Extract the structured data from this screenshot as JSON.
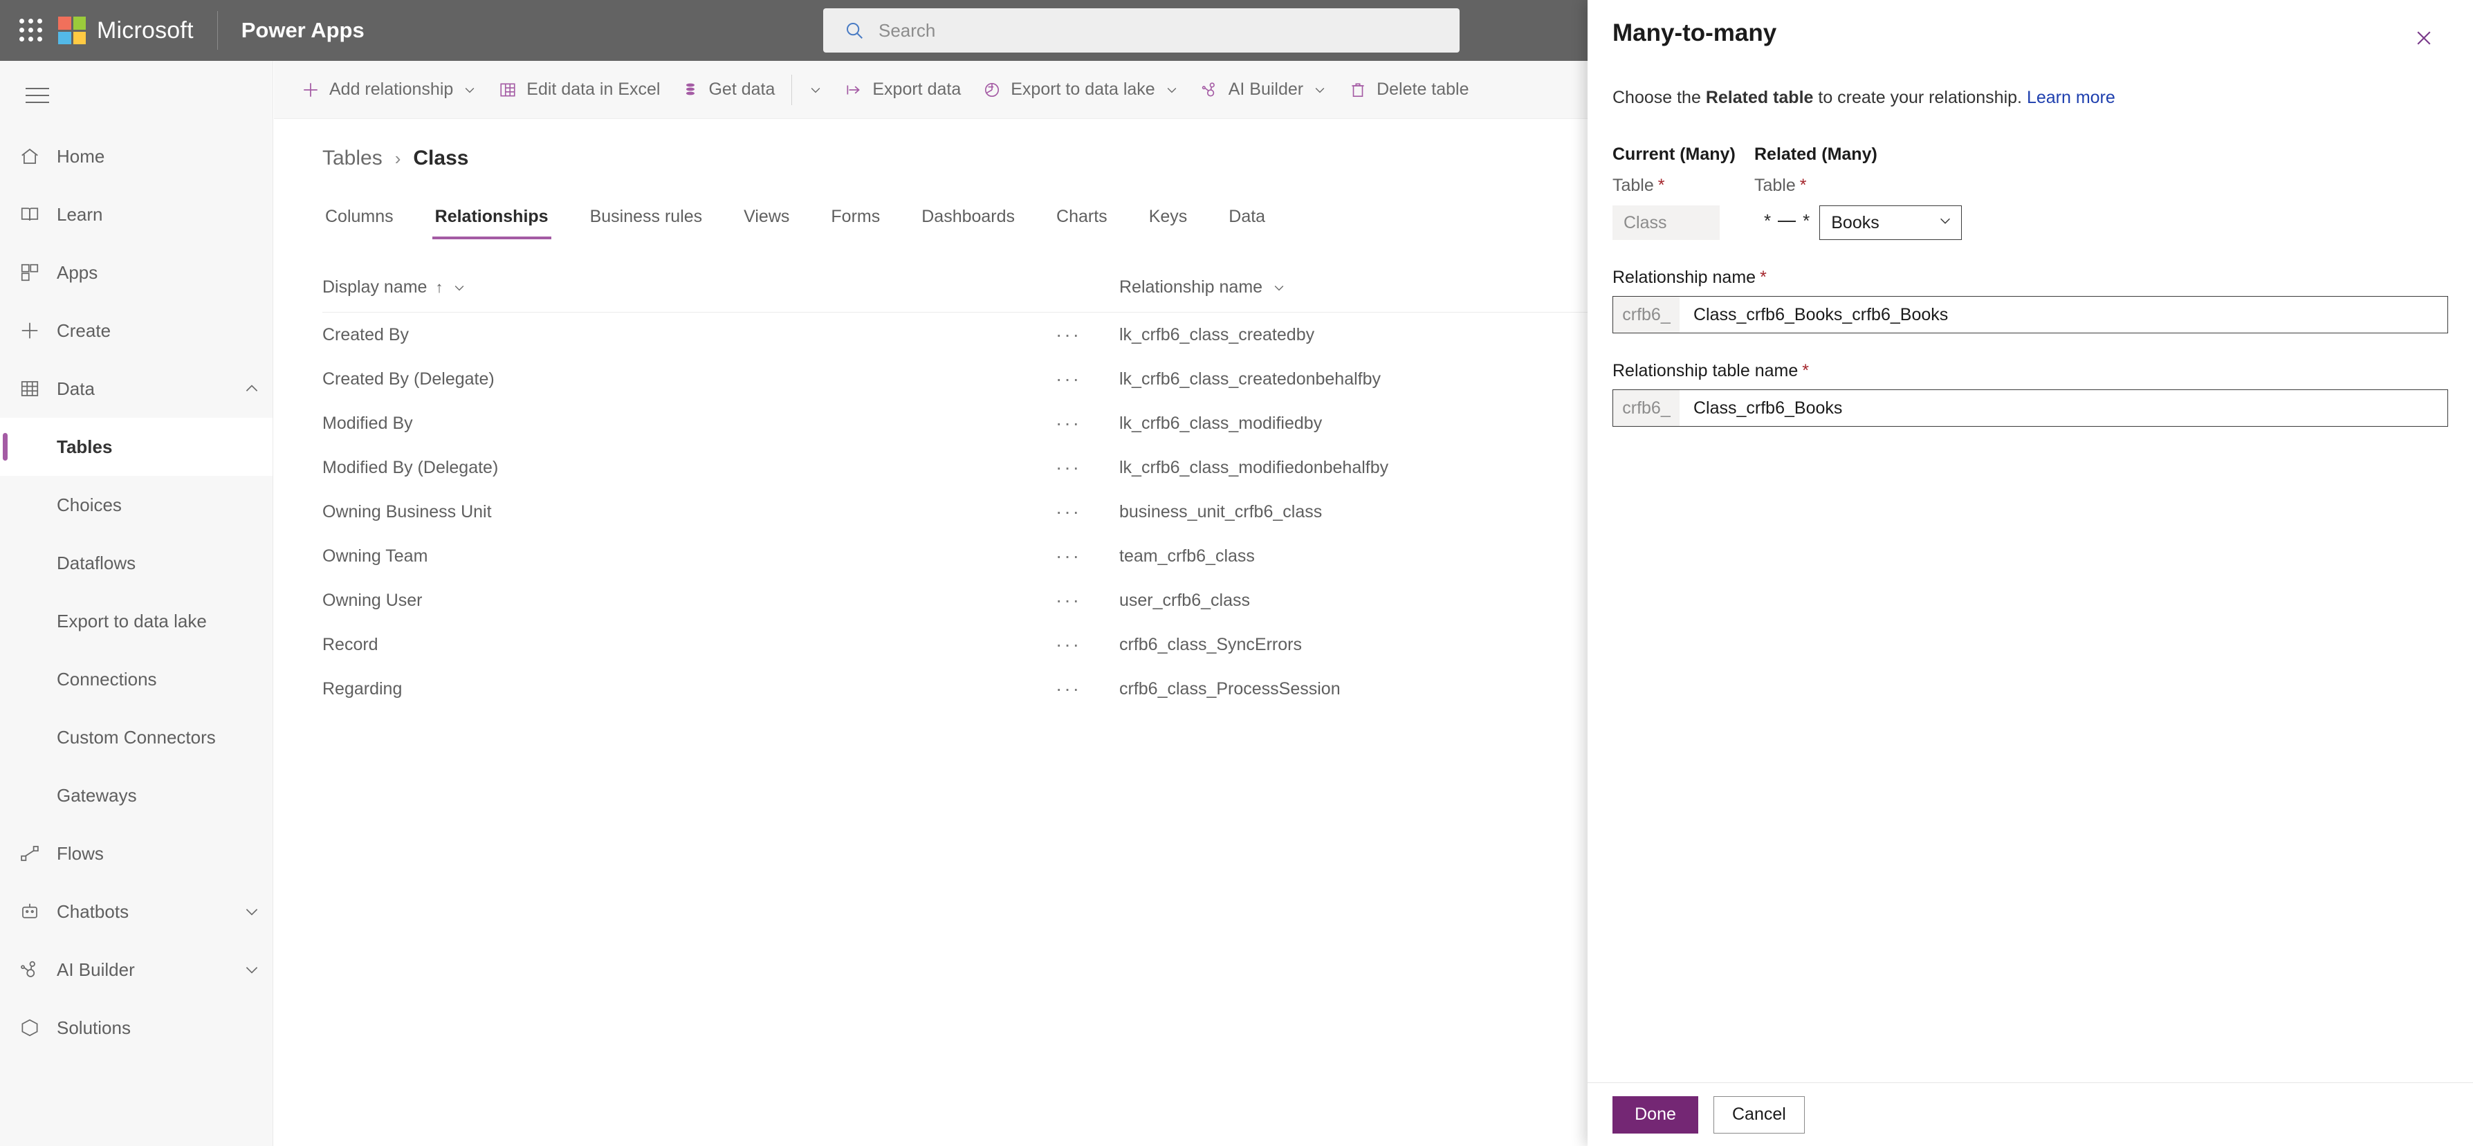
{
  "topbar": {
    "waffle_icon": "app-launcher-icon",
    "brand": "Microsoft",
    "app_name": "Power Apps",
    "search": {
      "placeholder": "Search",
      "value": "",
      "icon": "search-icon"
    }
  },
  "sidebar": {
    "menu_icon": "hamburger-icon",
    "items": [
      {
        "label": "Home",
        "icon": "home-icon",
        "type": "item",
        "chevron": ""
      },
      {
        "label": "Learn",
        "icon": "book-icon",
        "type": "item",
        "chevron": ""
      },
      {
        "label": "Apps",
        "icon": "apps-grid-icon",
        "type": "item",
        "chevron": ""
      },
      {
        "label": "Create",
        "icon": "plus-icon",
        "type": "item",
        "chevron": ""
      },
      {
        "label": "Data",
        "icon": "table-grid-icon",
        "type": "item",
        "chevron": "chevron-up-icon"
      },
      {
        "label": "Tables",
        "icon": "",
        "type": "sub",
        "selected": true
      },
      {
        "label": "Choices",
        "icon": "",
        "type": "sub",
        "selected": false
      },
      {
        "label": "Dataflows",
        "icon": "",
        "type": "sub",
        "selected": false
      },
      {
        "label": "Export to data lake",
        "icon": "",
        "type": "sub",
        "selected": false
      },
      {
        "label": "Connections",
        "icon": "",
        "type": "sub",
        "selected": false
      },
      {
        "label": "Custom Connectors",
        "icon": "",
        "type": "sub",
        "selected": false
      },
      {
        "label": "Gateways",
        "icon": "",
        "type": "sub",
        "selected": false
      },
      {
        "label": "Flows",
        "icon": "flow-icon",
        "type": "item",
        "chevron": ""
      },
      {
        "label": "Chatbots",
        "icon": "chatbot-icon",
        "type": "item",
        "chevron": "chevron-down-icon"
      },
      {
        "label": "AI Builder",
        "icon": "ai-builder-icon",
        "type": "item",
        "chevron": "chevron-down-icon"
      },
      {
        "label": "Solutions",
        "icon": "solutions-icon",
        "type": "item",
        "chevron": ""
      }
    ]
  },
  "commandbar": {
    "items": [
      {
        "label": "Add relationship",
        "icon": "plus-icon",
        "caret": true
      },
      {
        "label": "Edit data in Excel",
        "icon": "excel-icon",
        "caret": false
      },
      {
        "label": "Get data",
        "icon": "database-icon",
        "caret": false
      },
      {
        "label": "",
        "icon": "",
        "caret": true,
        "caret_only": true
      },
      {
        "label": "Export data",
        "icon": "export-icon",
        "caret": false
      },
      {
        "label": "Export to data lake",
        "icon": "datalake-icon",
        "caret": true
      },
      {
        "label": "AI Builder",
        "icon": "ai-builder-icon",
        "caret": true
      },
      {
        "label": "Delete table",
        "icon": "trash-icon",
        "caret": false
      }
    ]
  },
  "breadcrumb": {
    "parent": "Tables",
    "separator": "›",
    "current": "Class"
  },
  "tabs": [
    {
      "label": "Columns",
      "active": false
    },
    {
      "label": "Relationships",
      "active": true
    },
    {
      "label": "Business rules",
      "active": false
    },
    {
      "label": "Views",
      "active": false
    },
    {
      "label": "Forms",
      "active": false
    },
    {
      "label": "Dashboards",
      "active": false
    },
    {
      "label": "Charts",
      "active": false
    },
    {
      "label": "Keys",
      "active": false
    },
    {
      "label": "Data",
      "active": false
    }
  ],
  "grid": {
    "columns": [
      {
        "label": "Display name",
        "sort": "↑",
        "chevron": "chevron-down-icon"
      },
      {
        "label": "Relationship name",
        "sort": "",
        "chevron": "chevron-down-icon"
      }
    ],
    "row_menu_icon": "ellipsis-icon",
    "row_menu_glyph": "···",
    "rows": [
      {
        "display_name": "Created By",
        "relationship_name": "lk_crfb6_class_createdby"
      },
      {
        "display_name": "Created By (Delegate)",
        "relationship_name": "lk_crfb6_class_createdonbehalfby"
      },
      {
        "display_name": "Modified By",
        "relationship_name": "lk_crfb6_class_modifiedby"
      },
      {
        "display_name": "Modified By (Delegate)",
        "relationship_name": "lk_crfb6_class_modifiedonbehalfby"
      },
      {
        "display_name": "Owning Business Unit",
        "relationship_name": "business_unit_crfb6_class"
      },
      {
        "display_name": "Owning Team",
        "relationship_name": "team_crfb6_class"
      },
      {
        "display_name": "Owning User",
        "relationship_name": "user_crfb6_class"
      },
      {
        "display_name": "Record",
        "relationship_name": "crfb6_class_SyncErrors"
      },
      {
        "display_name": "Regarding",
        "relationship_name": "crfb6_class_ProcessSession"
      }
    ]
  },
  "panel": {
    "title": "Many-to-many",
    "close_icon": "close-icon",
    "subtitle_pre": "Choose the ",
    "subtitle_bold": "Related table",
    "subtitle_post": " to create your relationship. ",
    "subtitle_link": "Learn more",
    "current_group": {
      "title": "Current (Many)",
      "field_label": "Table",
      "required": "*",
      "value": "Class"
    },
    "connector": {
      "left": "*",
      "right": "*"
    },
    "related_group": {
      "title": "Related (Many)",
      "field_label": "Table",
      "required": "*",
      "value": "Books",
      "chevron": "chevron-down-icon"
    },
    "relationship_name": {
      "label": "Relationship name",
      "required": "*",
      "prefix": "crfb6_",
      "value": "Class_crfb6_Books_crfb6_Books"
    },
    "relationship_table_name": {
      "label": "Relationship table name",
      "required": "*",
      "prefix": "crfb6_",
      "value": "Class_crfb6_Books"
    },
    "footer": {
      "primary": "Done",
      "secondary": "Cancel"
    }
  },
  "colors": {
    "header_bg": "#636363",
    "accent_purple": "#a45ba4",
    "primary_button": "#742774",
    "link_blue": "#1e3fae",
    "required_red": "#a4262c"
  }
}
